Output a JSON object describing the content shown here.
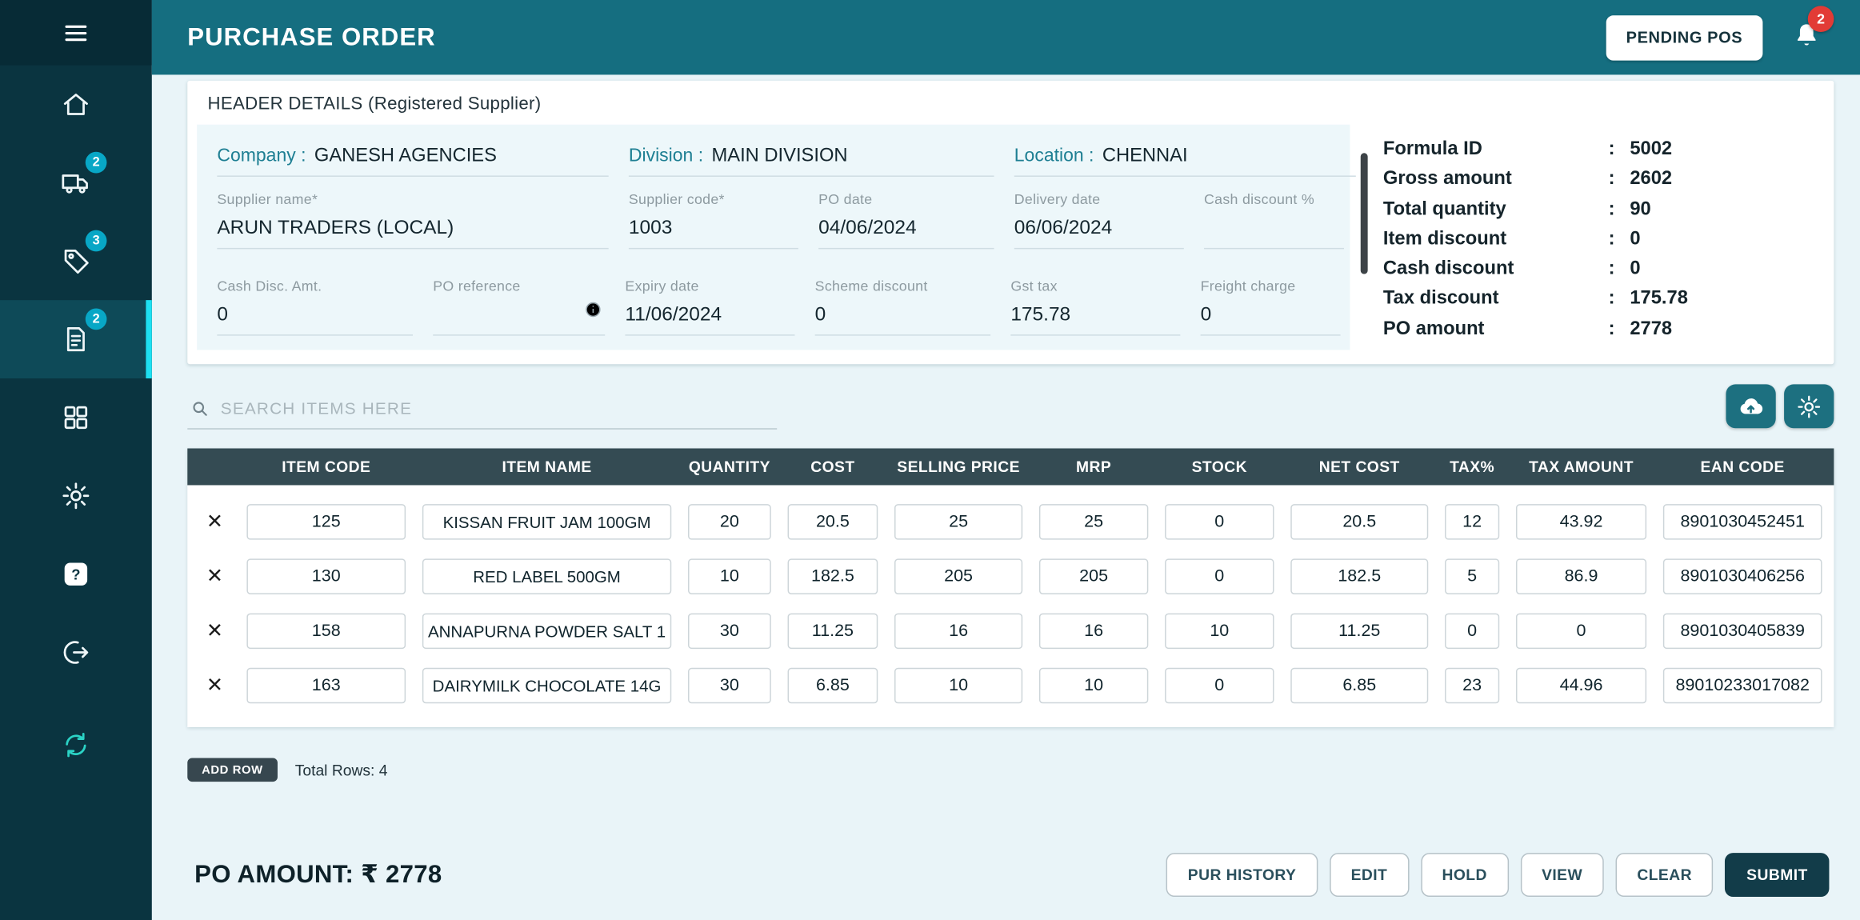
{
  "colors": {
    "sidebar": "#0a3440",
    "sidebar_top": "#072b36",
    "sidebar_active": "#0e4a58",
    "accent": "#1ee0f2",
    "badge": "#08a7c6",
    "danger": "#e23b36",
    "topbar": "#156e80",
    "content": "#e9f4f8",
    "fieldbg": "#edf7fa",
    "thead": "#344b53",
    "tealbtn": "#1d7080",
    "submit": "#123c49",
    "tealtext": "#1e7f93"
  },
  "sidebar": {
    "menu_icon": "hamburger-icon",
    "items": [
      {
        "name": "home",
        "icon": "home-icon"
      },
      {
        "name": "delivery",
        "icon": "truck-icon",
        "badge": "2"
      },
      {
        "name": "orders",
        "icon": "tag-icon",
        "badge": "3"
      },
      {
        "name": "purchase-order",
        "icon": "document-edit-icon",
        "badge": "2",
        "active": true
      },
      {
        "name": "modules",
        "icon": "grid-icon"
      },
      {
        "name": "settings",
        "icon": "gear-icon"
      },
      {
        "name": "help",
        "icon": "question-icon"
      },
      {
        "name": "logout",
        "icon": "logout-icon"
      },
      {
        "name": "sync",
        "icon": "sync-icon"
      }
    ]
  },
  "header": {
    "title": "PURCHASE ORDER",
    "pending_button": "PENDING POS",
    "notification_count": "2",
    "bell_icon": "bell-icon"
  },
  "header_details": {
    "title": "HEADER DETAILS (Registered Supplier)",
    "company_label": "Company :",
    "company": "GANESH AGENCIES",
    "division_label": "Division :",
    "division": "MAIN DIVISION",
    "location_label": "Location :",
    "location": "CHENNAI",
    "fields_row2": [
      {
        "label": "Supplier name*",
        "value": "ARUN TRADERS (LOCAL)"
      },
      {
        "label": "Supplier code*",
        "value": "1003"
      },
      {
        "label": "PO date",
        "value": "04/06/2024"
      },
      {
        "label": "Delivery date",
        "value": "06/06/2024"
      },
      {
        "label": "Cash discount %",
        "value": ""
      }
    ],
    "fields_row3": [
      {
        "label": "Cash Disc. Amt.",
        "value": "0"
      },
      {
        "label": "PO reference",
        "value": "",
        "info": true
      },
      {
        "label": "Expiry date",
        "value": "11/06/2024"
      },
      {
        "label": "Scheme discount",
        "value": "0"
      },
      {
        "label": "Gst tax",
        "value": "175.78"
      },
      {
        "label": "Freight charge",
        "value": "0"
      }
    ]
  },
  "summary": {
    "rows": [
      {
        "label": "Formula ID",
        "value": "5002"
      },
      {
        "label": "Gross amount",
        "value": "2602"
      },
      {
        "label": "Total quantity",
        "value": "90"
      },
      {
        "label": "Item discount",
        "value": "0"
      },
      {
        "label": "Cash discount",
        "value": "0"
      },
      {
        "label": "Tax discount",
        "value": "175.78"
      },
      {
        "label": "PO amount",
        "value": "2778"
      }
    ]
  },
  "search": {
    "placeholder": "SEARCH ITEMS HERE",
    "icon": "search-icon"
  },
  "toolbar": {
    "upload_icon": "cloud-upload-icon",
    "settings_icon": "gear-icon"
  },
  "table": {
    "columns": [
      "ITEM CODE",
      "ITEM NAME",
      "QUANTITY",
      "COST",
      "SELLING PRICE",
      "MRP",
      "STOCK",
      "NET COST",
      "TAX%",
      "TAX AMOUNT",
      "EAN CODE"
    ],
    "delete_icon": "close-x-icon",
    "rows": [
      [
        "125",
        "KISSAN FRUIT JAM 100GM",
        "20",
        "20.5",
        "25",
        "25",
        "0",
        "20.5",
        "12",
        "43.92",
        "8901030452451"
      ],
      [
        "130",
        "RED LABEL 500GM",
        "10",
        "182.5",
        "205",
        "205",
        "0",
        "182.5",
        "5",
        "86.9",
        "8901030406256"
      ],
      [
        "158",
        "ANNAPURNA POWDER SALT 1",
        "30",
        "11.25",
        "16",
        "16",
        "10",
        "11.25",
        "0",
        "0",
        "8901030405839"
      ],
      [
        "163",
        "DAIRYMILK CHOCOLATE 14G",
        "30",
        "6.85",
        "10",
        "10",
        "0",
        "6.85",
        "23",
        "44.96",
        "89010233017082"
      ]
    ]
  },
  "footer": {
    "add_row": "ADD ROW",
    "total_rows": "Total Rows: 4",
    "po_amount": "PO AMOUNT: ₹ 2778",
    "action_buttons": [
      "PUR HISTORY",
      "EDIT",
      "HOLD",
      "VIEW",
      "CLEAR"
    ],
    "submit": "SUBMIT"
  }
}
